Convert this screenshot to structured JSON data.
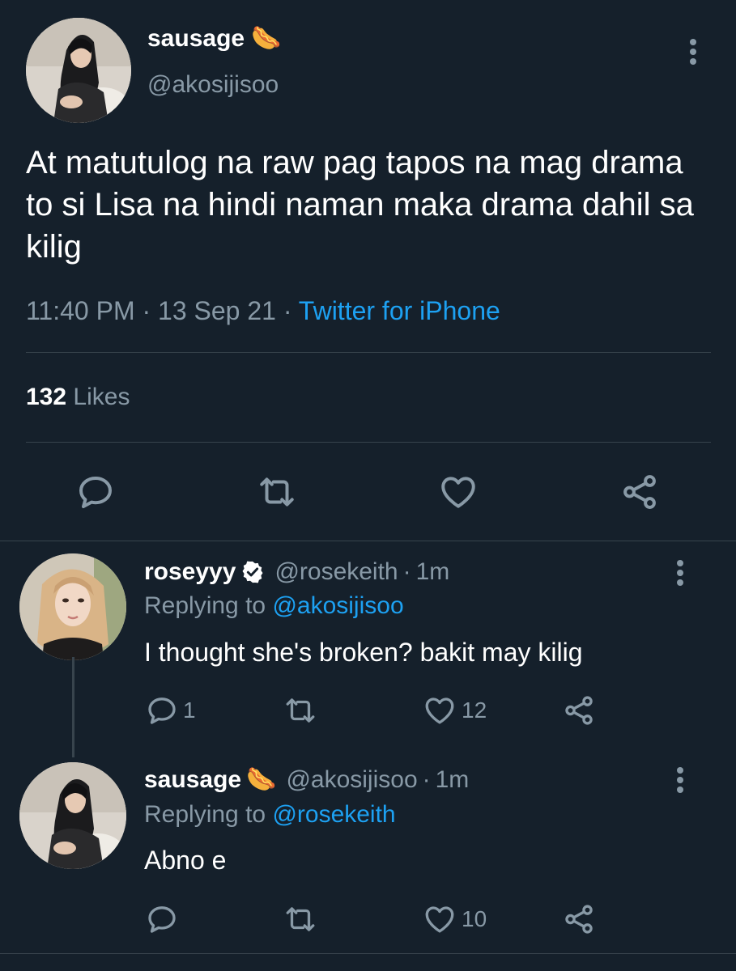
{
  "main_tweet": {
    "display_name": "sausage",
    "name_emoji": "🌭",
    "handle": "@akosijisoo",
    "text": "At matutulog na raw pag tapos na mag drama to si Lisa na hindi naman maka drama dahil sa kilig",
    "time": "11:40 PM",
    "date": "13 Sep 21",
    "source": "Twitter for iPhone",
    "likes_count": "132",
    "likes_label": "Likes",
    "separator": "·"
  },
  "replies": [
    {
      "display_name": "roseyyy",
      "verified": true,
      "handle": "@rosekeith",
      "time": "1m",
      "replying_prefix": "Replying to",
      "replying_to": "@akosijisoo",
      "text": "I thought she's broken? bakit may kilig",
      "reply_count": "1",
      "retweet_count": "",
      "like_count": "12"
    },
    {
      "display_name": "sausage",
      "name_emoji": "🌭",
      "handle": "@akosijisoo",
      "time": "1m",
      "replying_prefix": "Replying to",
      "replying_to": "@rosekeith",
      "text": "Abno e",
      "reply_count": "",
      "retweet_count": "",
      "like_count": "10"
    }
  ],
  "icons": {
    "reply": "reply-icon",
    "retweet": "retweet-icon",
    "like": "heart-icon",
    "share": "share-icon",
    "more": "more-vertical-icon",
    "verified": "verified-badge-icon"
  },
  "colors": {
    "background": "#15202b",
    "text_secondary": "#8899a6",
    "link": "#1da1f2",
    "divider": "#38444d"
  }
}
